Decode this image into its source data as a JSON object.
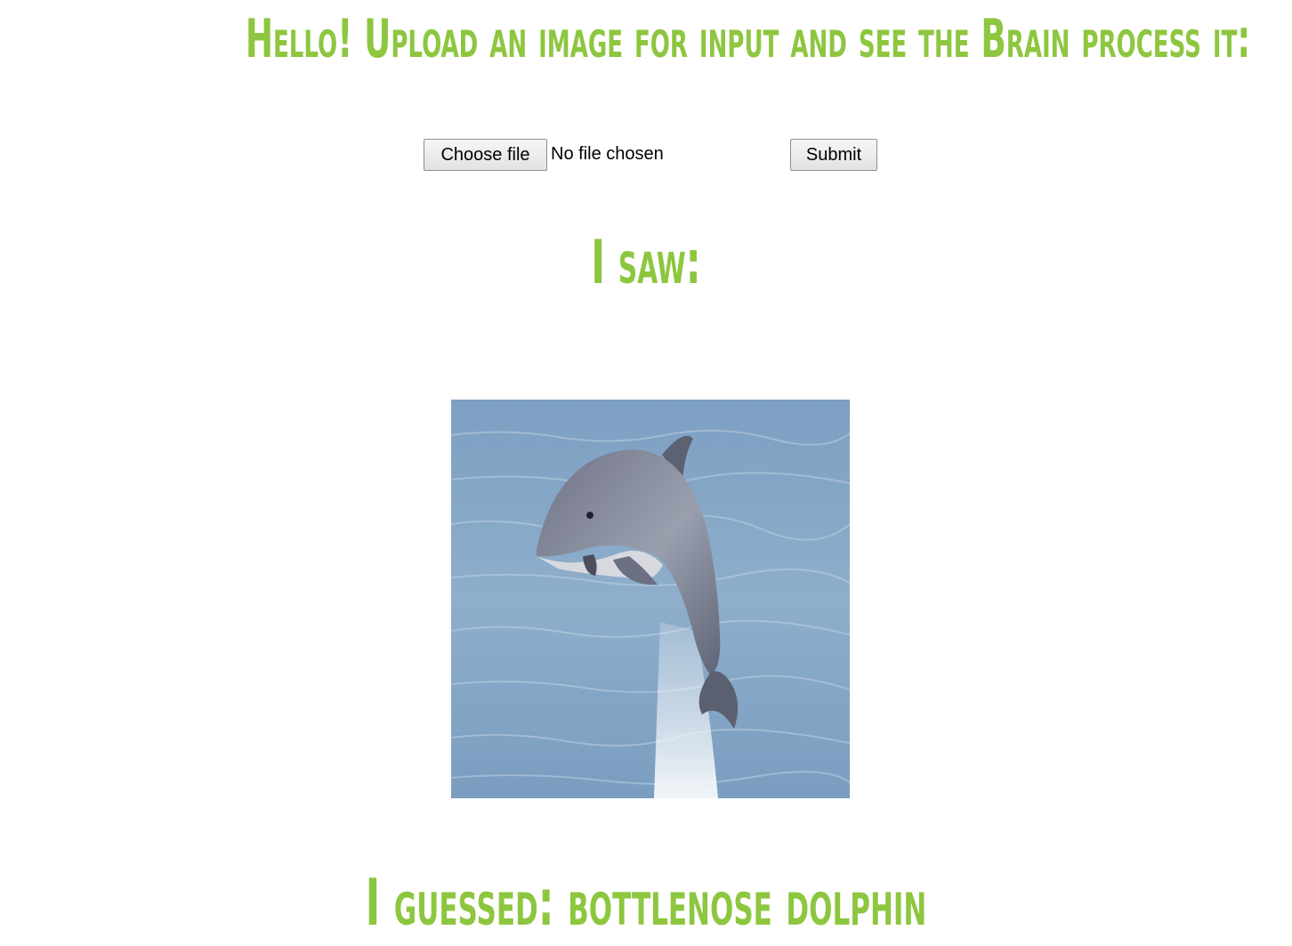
{
  "page": {
    "title": "Hello! Upload an image for input and see the Brain process it:",
    "saw_heading": "I saw:",
    "guess_label": "I guessed:",
    "guess_value": "bottlenose dolphin"
  },
  "form": {
    "choose_file_label": "Choose file",
    "file_status": "No file chosen",
    "submit_label": "Submit"
  },
  "preview": {
    "subject": "dolphin-photo"
  },
  "colors": {
    "accent": "#8dc63f",
    "water": "#86a7c5",
    "dolphin": "#8a8e9e"
  }
}
